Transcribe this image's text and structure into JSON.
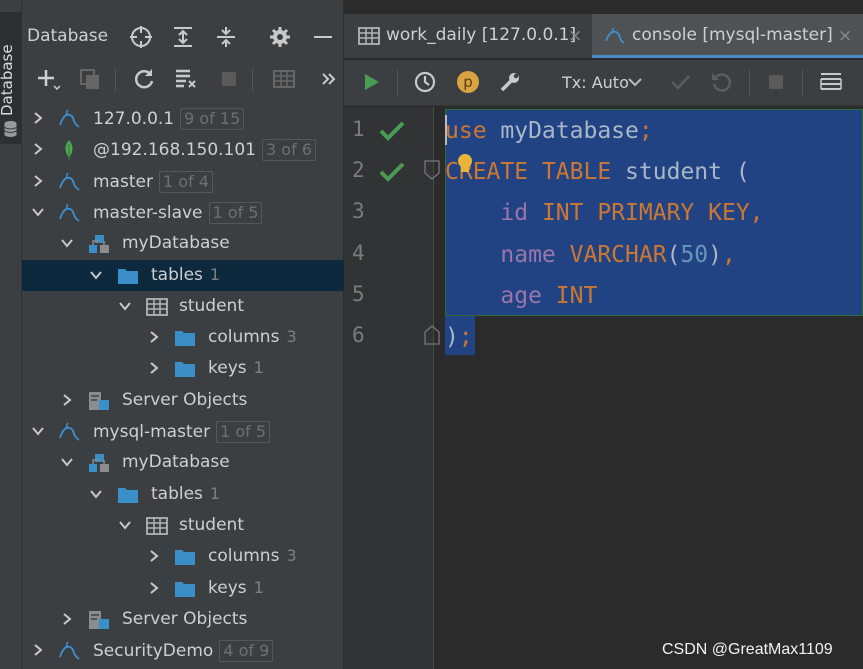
{
  "side_tab": {
    "label": "Database"
  },
  "db_panel": {
    "title": "Database",
    "header_icons": [
      "crosshair-icon",
      "expand-all-icon",
      "collapse-all-icon",
      "gear-icon",
      "minimize-icon"
    ],
    "toolbar_icons": [
      "add-icon",
      "copy-icon",
      "refresh-icon",
      "schema-icon",
      "stop-icon",
      "table-icon",
      "more-icon"
    ]
  },
  "tree": [
    {
      "label": "127.0.0.1",
      "badge": "9 of 15",
      "icon": "mysql-icon",
      "state": "collapsed"
    },
    {
      "label": "@192.168.150.101",
      "badge": "3 of 6",
      "icon": "mongodb-leaf-icon",
      "state": "collapsed"
    },
    {
      "label": "master",
      "badge": "1 of 4",
      "icon": "mysql-icon",
      "state": "collapsed"
    },
    {
      "label": "master-slave",
      "badge": "1 of 5",
      "icon": "mysql-icon",
      "state": "expanded"
    },
    {
      "label": "myDatabase",
      "icon": "schema-icon",
      "state": "expanded"
    },
    {
      "label": "tables",
      "count": "1",
      "icon": "folder-icon",
      "state": "expanded",
      "selected": true
    },
    {
      "label": "student",
      "icon": "table-icon",
      "state": "expanded"
    },
    {
      "label": "columns",
      "count": "3",
      "icon": "folder-icon",
      "state": "collapsed"
    },
    {
      "label": "keys",
      "count": "1",
      "icon": "folder-icon",
      "state": "collapsed"
    },
    {
      "label": "Server Objects",
      "icon": "server-objects-icon",
      "state": "collapsed"
    },
    {
      "label": "mysql-master",
      "badge": "1 of 5",
      "icon": "mysql-icon",
      "state": "expanded"
    },
    {
      "label": "myDatabase",
      "icon": "schema-icon",
      "state": "expanded"
    },
    {
      "label": "tables",
      "count": "1",
      "icon": "folder-icon",
      "state": "expanded"
    },
    {
      "label": "student",
      "icon": "table-icon",
      "state": "expanded"
    },
    {
      "label": "columns",
      "count": "3",
      "icon": "folder-icon",
      "state": "collapsed"
    },
    {
      "label": "keys",
      "count": "1",
      "icon": "folder-icon",
      "state": "collapsed"
    },
    {
      "label": "Server Objects",
      "icon": "server-objects-icon",
      "state": "collapsed"
    },
    {
      "label": "SecurityDemo",
      "badge": "4 of 9",
      "icon": "mysql-icon",
      "state": "collapsed"
    }
  ],
  "tabs": [
    {
      "label": "work_daily [127.0.0.1]",
      "close": "×",
      "icon": "table-icon",
      "active": false
    },
    {
      "label": "console [mysql-master]",
      "close": "×",
      "icon": "mysql-icon",
      "active": true
    }
  ],
  "editor_toolbar": {
    "icons": [
      "run-icon",
      "history-icon",
      "parameter-icon",
      "wrench-icon",
      "commit-icon",
      "rollback-icon",
      "stop-icon",
      "output-icon"
    ],
    "tx_mode": "Tx: Auto",
    "param_letter": "p"
  },
  "code": {
    "line_numbers": [
      "1",
      "2",
      "3",
      "4",
      "5",
      "6"
    ],
    "lines": [
      [
        [
          "kw",
          "use"
        ],
        [
          "id",
          " myDatabase"
        ],
        [
          "pun",
          ";"
        ]
      ],
      [
        [
          "kw",
          "CREATE"
        ],
        [
          "id",
          " "
        ],
        [
          "kw",
          "TABLE"
        ],
        [
          "id",
          " student ("
        ]
      ],
      [
        [
          "id",
          "    "
        ],
        [
          "ident2",
          "id"
        ],
        [
          "id",
          " "
        ],
        [
          "kw",
          "INT PRIMARY KEY"
        ],
        [
          "pun",
          ","
        ]
      ],
      [
        [
          "id",
          "    "
        ],
        [
          "ident2",
          "name"
        ],
        [
          "id",
          " "
        ],
        [
          "kw",
          "VARCHAR"
        ],
        [
          "id",
          "("
        ],
        [
          "num",
          "50"
        ],
        [
          "id",
          ")"
        ],
        [
          "pun",
          ","
        ]
      ],
      [
        [
          "id",
          "    "
        ],
        [
          "ident2",
          "age"
        ],
        [
          "id",
          " "
        ],
        [
          "kw",
          "INT"
        ]
      ],
      [
        [
          "id",
          ")"
        ],
        [
          "pun",
          ";"
        ]
      ]
    ],
    "executed_lines": [
      "1",
      "2"
    ]
  },
  "watermark": "CSDN @GreatMax1109",
  "colors": {
    "keyword": "#cc7832",
    "identifier": "#a9b7c6",
    "number": "#6897bb",
    "selection": "#214283",
    "check": "#499c54",
    "mysql_icon": "#3d8fd1",
    "folder": "#3a8fc9"
  }
}
